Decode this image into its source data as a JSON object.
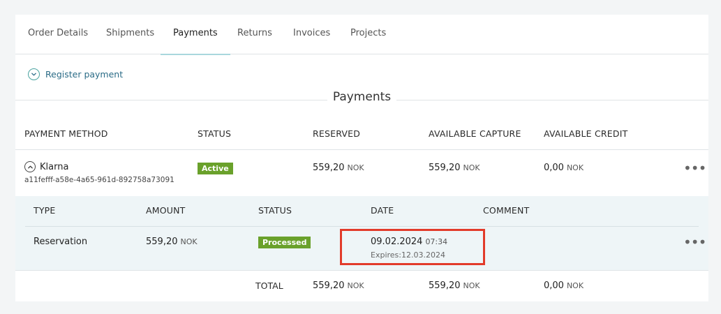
{
  "tabs": [
    {
      "label": "Order Details"
    },
    {
      "label": "Shipments"
    },
    {
      "label": "Payments"
    },
    {
      "label": "Returns"
    },
    {
      "label": "Invoices"
    },
    {
      "label": "Projects"
    }
  ],
  "active_tab": "Payments",
  "register_payment_label": "Register payment",
  "section_title": "Payments",
  "payments_table": {
    "headers": [
      "PAYMENT METHOD",
      "STATUS",
      "RESERVED",
      "AVAILABLE CAPTURE",
      "AVAILABLE CREDIT"
    ],
    "row": {
      "method": "Klarna",
      "reference": "a11fefff-a58e-4a65-961d-892758a73091",
      "status": "Active",
      "reserved": "559,20",
      "reserved_currency": "NOK",
      "available_capture": "559,20",
      "available_capture_currency": "NOK",
      "available_credit": "0,00",
      "available_credit_currency": "NOK"
    }
  },
  "transactions_table": {
    "headers": [
      "TYPE",
      "AMOUNT",
      "STATUS",
      "DATE",
      "COMMENT"
    ],
    "row": {
      "type": "Reservation",
      "amount": "559,20",
      "amount_currency": "NOK",
      "status": "Processed",
      "date": "09.02.2024",
      "time": "07:34",
      "expires": "Expires:12.03.2024"
    }
  },
  "total": {
    "label": "TOTAL",
    "reserved": "559,20",
    "reserved_currency": "NOK",
    "capture": "559,20",
    "capture_currency": "NOK",
    "credit": "0,00",
    "credit_currency": "NOK"
  },
  "colors": {
    "accent": "#a9d7dd",
    "link": "#2a6b86",
    "badge_green": "#6aa12b",
    "highlight": "#e23b2a",
    "sub_panel_bg": "#eef5f7"
  },
  "icons": {
    "register_toggle": "chevron-down-circle-icon",
    "method_toggle": "chevron-up-circle-icon",
    "row_menu": "more-dots-icon"
  }
}
